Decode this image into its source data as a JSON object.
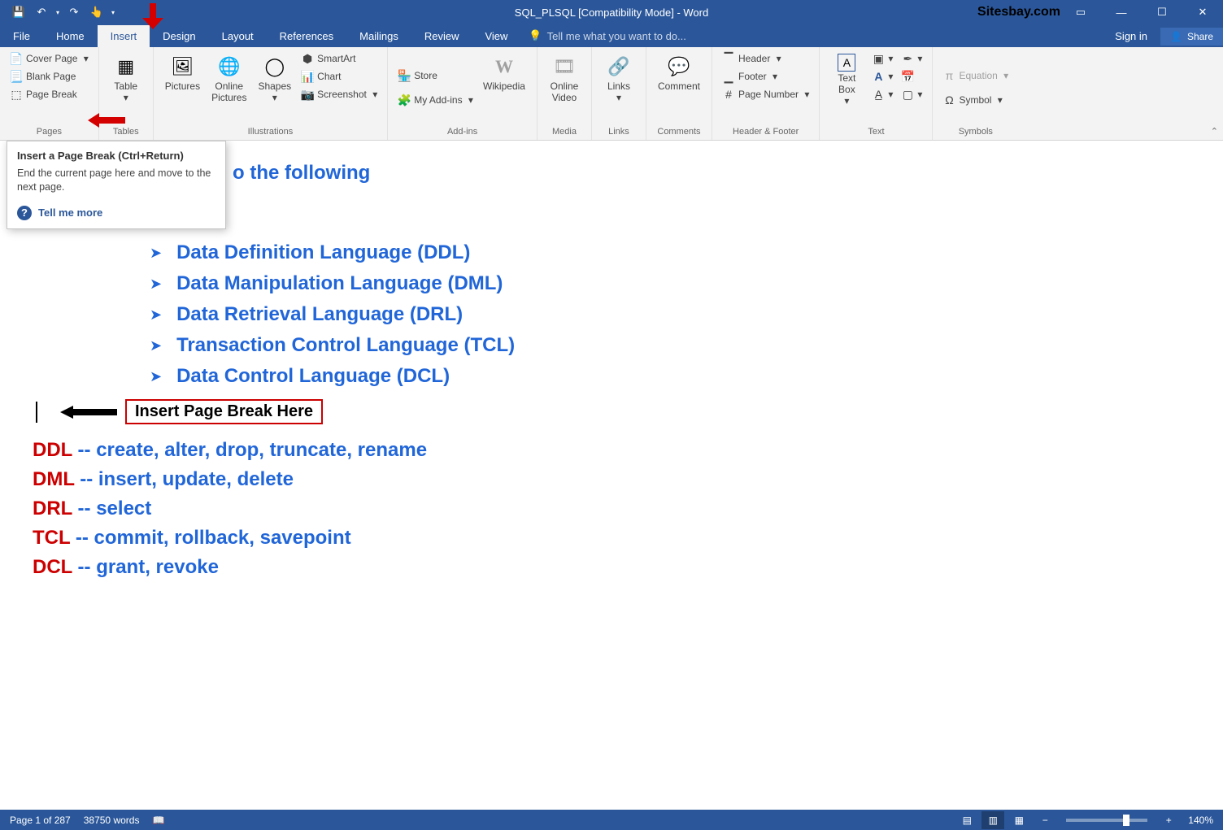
{
  "titlebar": {
    "title": "SQL_PLSQL [Compatibility Mode] - Word",
    "sitesbay": "Sitesbay.com"
  },
  "menu": {
    "file": "File",
    "home": "Home",
    "insert": "Insert",
    "design": "Design",
    "layout": "Layout",
    "references": "References",
    "mailings": "Mailings",
    "review": "Review",
    "view": "View",
    "tellme": "Tell me what you want to do...",
    "signin": "Sign in",
    "share": "Share"
  },
  "ribbon": {
    "pages": {
      "label": "Pages",
      "cover": "Cover Page",
      "blank": "Blank Page",
      "break": "Page Break"
    },
    "tables": {
      "label": "Tables",
      "table": "Table"
    },
    "illus": {
      "label": "Illustrations",
      "pictures": "Pictures",
      "online": "Online\nPictures",
      "shapes": "Shapes",
      "smart": "SmartArt",
      "chart": "Chart",
      "screenshot": "Screenshot"
    },
    "addins": {
      "label": "Add-ins",
      "store": "Store",
      "my": "My Add-ins",
      "wiki": "Wikipedia"
    },
    "media": {
      "label": "Media",
      "video": "Online\nVideo"
    },
    "links": {
      "label": "Links",
      "links_btn": "Links"
    },
    "comments": {
      "label": "Comments",
      "comment": "Comment"
    },
    "hf": {
      "label": "Header & Footer",
      "header": "Header",
      "footer": "Footer",
      "pagenum": "Page Number"
    },
    "text": {
      "label": "Text",
      "textbox": "Text\nBox"
    },
    "symbols": {
      "label": "Symbols",
      "equation": "Equation",
      "symbol": "Symbol"
    }
  },
  "tooltip": {
    "title": "Insert a Page Break (Ctrl+Return)",
    "body": "End the current page here and move to the next page.",
    "more": "Tell me more"
  },
  "doc": {
    "heading_partial": "o the following",
    "bullets": [
      "Data Definition Language (DDL)",
      "Data Manipulation Language (DML)",
      "Data Retrieval Language (DRL)",
      "Transaction Control Language (TCL)",
      "Data Control Language (DCL)"
    ],
    "insert_label": "Insert Page Break Here",
    "defs": [
      {
        "k": "DDL",
        "v": " -- create, alter, drop, truncate, rename"
      },
      {
        "k": "DML",
        "v": " -- insert, update, delete"
      },
      {
        "k": "DRL",
        "v": " -- select"
      },
      {
        "k": "TCL",
        "v": " -- commit, rollback, savepoint"
      },
      {
        "k": "DCL",
        "v": " -- grant, revoke"
      }
    ]
  },
  "status": {
    "page": "Page 1 of 287",
    "words": "38750 words",
    "zoom": "140%"
  }
}
